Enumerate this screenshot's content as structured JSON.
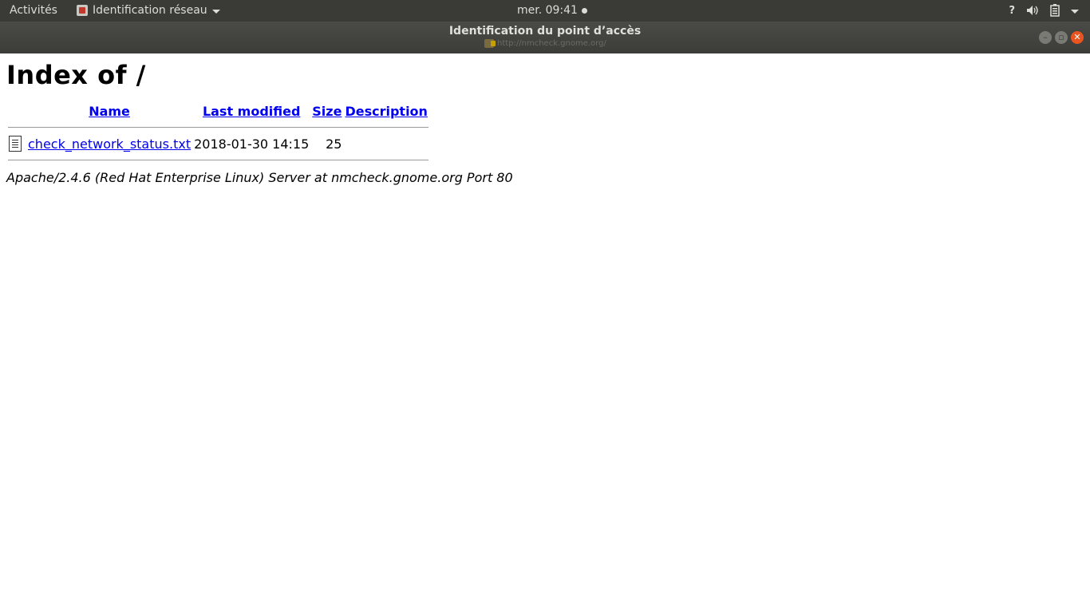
{
  "topbar": {
    "activities": "Activités",
    "app_menu": "Identification réseau",
    "clock": "mer. 09:41",
    "help": "?"
  },
  "window": {
    "title": "Identification du point d’accès",
    "url": "http://nmcheck.gnome.org/"
  },
  "page": {
    "heading": "Index of /",
    "columns": [
      "Name",
      "Last modified",
      "Size",
      "Description"
    ],
    "rows": [
      {
        "name": "check_network_status.txt",
        "modified": "2018-01-30 14:15",
        "size": "25",
        "description": ""
      }
    ],
    "footer": "Apache/2.4.6 (Red Hat Enterprise Linux) Server at nmcheck.gnome.org Port 80"
  }
}
